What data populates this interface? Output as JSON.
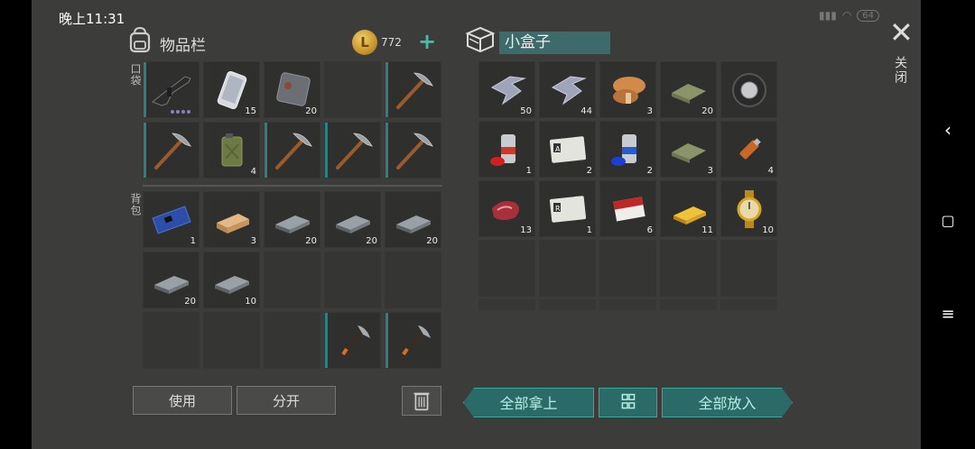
{
  "status": {
    "time": "晚上11:31",
    "battery": "64"
  },
  "inventory": {
    "title": "物品栏",
    "coins": "772",
    "section_pockets": "口袋",
    "section_backpack": "背包",
    "pockets": [
      {
        "icon": "rifle-icon",
        "qty": "",
        "bar": true
      },
      {
        "icon": "phone-icon",
        "qty": "15",
        "bar": false
      },
      {
        "icon": "metal-plate-icon",
        "qty": "20",
        "bar": false
      },
      {
        "icon": "",
        "qty": "",
        "bar": false
      },
      {
        "icon": "pickaxe-icon",
        "qty": "",
        "bar": true
      },
      {
        "icon": "pickaxe-icon",
        "qty": "",
        "bar": true
      },
      {
        "icon": "jerrycan-icon",
        "qty": "4",
        "bar": false
      },
      {
        "icon": "pickaxe-icon",
        "qty": "",
        "bar": true
      },
      {
        "icon": "pickaxe-icon",
        "qty": "",
        "bar": true
      },
      {
        "icon": "pickaxe-icon",
        "qty": "",
        "bar": true
      }
    ],
    "backpack": [
      {
        "icon": "circuit-board-icon",
        "qty": "1"
      },
      {
        "icon": "wood-plank-icon",
        "qty": "3"
      },
      {
        "icon": "iron-bar-icon",
        "qty": "20"
      },
      {
        "icon": "iron-bar-icon",
        "qty": "20"
      },
      {
        "icon": "iron-bar-icon",
        "qty": "20"
      },
      {
        "icon": "iron-bar-icon",
        "qty": "20"
      },
      {
        "icon": "iron-bar-icon",
        "qty": "10"
      },
      {
        "icon": "",
        "qty": ""
      },
      {
        "icon": "",
        "qty": ""
      },
      {
        "icon": "",
        "qty": ""
      },
      {
        "icon": "",
        "qty": ""
      },
      {
        "icon": "",
        "qty": ""
      },
      {
        "icon": "",
        "qty": ""
      },
      {
        "icon": "hatchet-icon",
        "qty": ""
      },
      {
        "icon": "hatchet-icon",
        "qty": ""
      }
    ],
    "use_label": "使用",
    "split_label": "分开"
  },
  "container": {
    "name": "小盒子",
    "close_label": "关闭",
    "items": [
      {
        "icon": "metal-scrap-icon",
        "qty": "50"
      },
      {
        "icon": "metal-scrap-icon",
        "qty": "44"
      },
      {
        "icon": "mushroom-icon",
        "qty": "3"
      },
      {
        "icon": "cloth-icon",
        "qty": "20"
      },
      {
        "icon": "tire-icon",
        "qty": ""
      },
      {
        "icon": "spray-paint-red-icon",
        "qty": "1"
      },
      {
        "icon": "army-card-a-icon",
        "qty": "2"
      },
      {
        "icon": "spray-paint-blue-icon",
        "qty": "2"
      },
      {
        "icon": "cloth-icon",
        "qty": "3"
      },
      {
        "icon": "usb-drive-icon",
        "qty": "4"
      },
      {
        "icon": "raw-meat-icon",
        "qty": "13"
      },
      {
        "icon": "army-card-r-icon",
        "qty": "1"
      },
      {
        "icon": "cigarette-pack-icon",
        "qty": "6"
      },
      {
        "icon": "gold-bar-icon",
        "qty": "11"
      },
      {
        "icon": "gold-watch-icon",
        "qty": "10"
      }
    ],
    "take_all_label": "全部拿上",
    "put_all_label": "全部放入",
    "card_text": "US ARMY"
  }
}
